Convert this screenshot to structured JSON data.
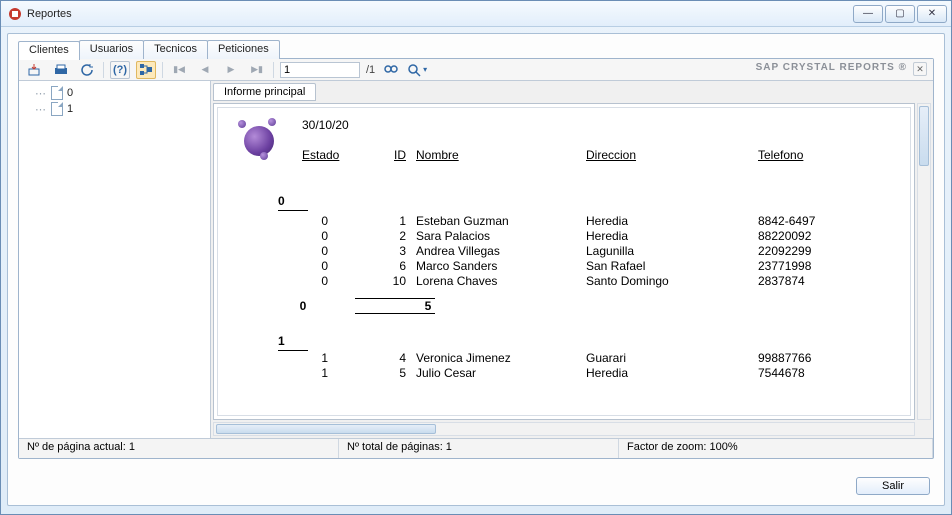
{
  "window": {
    "title": "Reportes"
  },
  "tabs": [
    "Clientes",
    "Usuarios",
    "Tecnicos",
    "Peticiones"
  ],
  "active_tab": 0,
  "toolbar": {
    "page_input": "1",
    "page_total": "/1",
    "brand": "SAP CRYSTAL REPORTS ®"
  },
  "tree": {
    "items": [
      "0",
      "1"
    ]
  },
  "report_tab": "Informe principal",
  "report": {
    "date": "30/10/20",
    "headers": {
      "estado": "Estado",
      "id": "ID",
      "nombre": "Nombre",
      "direccion": "Direccion",
      "telefono": "Telefono"
    },
    "groups": [
      {
        "key": "0",
        "rows": [
          {
            "estado": "0",
            "id": "1",
            "nombre": "Esteban Guzman",
            "direccion": "Heredia",
            "telefono": "8842-6497"
          },
          {
            "estado": "0",
            "id": "2",
            "nombre": "Sara Palacios",
            "direccion": "Heredia",
            "telefono": "88220092"
          },
          {
            "estado": "0",
            "id": "3",
            "nombre": "Andrea Villegas",
            "direccion": "Lagunilla",
            "telefono": "22092299"
          },
          {
            "estado": "0",
            "id": "6",
            "nombre": "Marco Sanders",
            "direccion": "San Rafael",
            "telefono": "23771998"
          },
          {
            "estado": "0",
            "id": "10",
            "nombre": "Lorena Chaves",
            "direccion": "Santo Domingo",
            "telefono": "2837874"
          }
        ],
        "subtotal": {
          "left": "0",
          "right": "5"
        }
      },
      {
        "key": "1",
        "rows": [
          {
            "estado": "1",
            "id": "4",
            "nombre": "Veronica Jimenez",
            "direccion": "Guarari",
            "telefono": "99887766"
          },
          {
            "estado": "1",
            "id": "5",
            "nombre": "Julio Cesar",
            "direccion": "Heredia",
            "telefono": "7544678"
          }
        ]
      }
    ]
  },
  "status": {
    "page_current": "Nº de página actual: 1",
    "page_total": "Nº total de páginas: 1",
    "zoom": "Factor de zoom: 100%"
  },
  "buttons": {
    "salir": "Salir"
  }
}
